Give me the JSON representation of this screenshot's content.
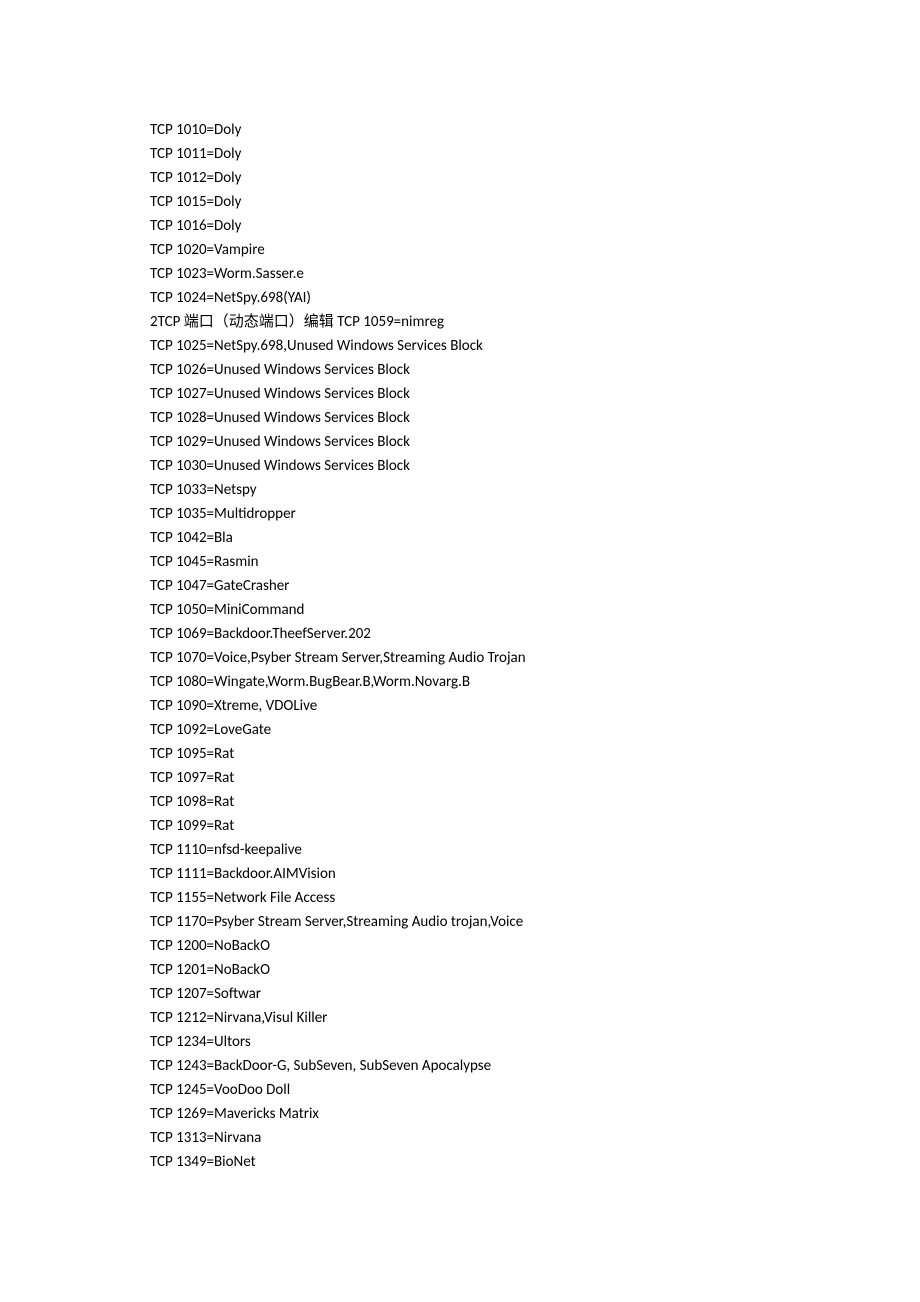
{
  "lines": [
    "TCP 1010=Doly",
    "TCP 1011=Doly",
    "TCP 1012=Doly",
    "TCP 1015=Doly",
    "TCP 1016=Doly",
    "TCP 1020=Vampire",
    "TCP 1023=Worm.Sasser.e",
    "TCP 1024=NetSpy.698(YAI)",
    "2TCP 端口（动态端口）编辑 TCP 1059=nimreg",
    "TCP 1025=NetSpy.698,Unused Windows Services Block",
    "TCP 1026=Unused Windows Services Block",
    "TCP 1027=Unused Windows Services Block",
    "TCP 1028=Unused Windows Services Block",
    "TCP 1029=Unused Windows Services Block",
    "TCP 1030=Unused Windows Services Block",
    "TCP 1033=Netspy",
    "TCP 1035=Multidropper",
    "TCP 1042=Bla",
    "TCP 1045=Rasmin",
    "TCP 1047=GateCrasher",
    "TCP 1050=MiniCommand",
    "TCP 1069=Backdoor.TheefServer.202",
    "TCP 1070=Voice,Psyber Stream Server,Streaming Audio Trojan",
    "TCP 1080=Wingate,Worm.BugBear.B,Worm.Novarg.B",
    "TCP 1090=Xtreme, VDOLive",
    "TCP 1092=LoveGate",
    "TCP 1095=Rat",
    "TCP 1097=Rat",
    "TCP 1098=Rat",
    "TCP 1099=Rat",
    "TCP 1110=nfsd-keepalive",
    "TCP 1111=Backdoor.AIMVision",
    "TCP 1155=Network File Access",
    "TCP 1170=Psyber Stream Server,Streaming Audio trojan,Voice",
    "TCP 1200=NoBackO",
    "TCP 1201=NoBackO",
    "TCP 1207=Softwar",
    "TCP 1212=Nirvana,Visul Killer",
    "TCP 1234=Ultors",
    "TCP 1243=BackDoor-G, SubSeven, SubSeven Apocalypse",
    "TCP 1245=VooDoo Doll",
    "TCP 1269=Mavericks Matrix",
    "TCP 1313=Nirvana",
    "TCP 1349=BioNet"
  ]
}
